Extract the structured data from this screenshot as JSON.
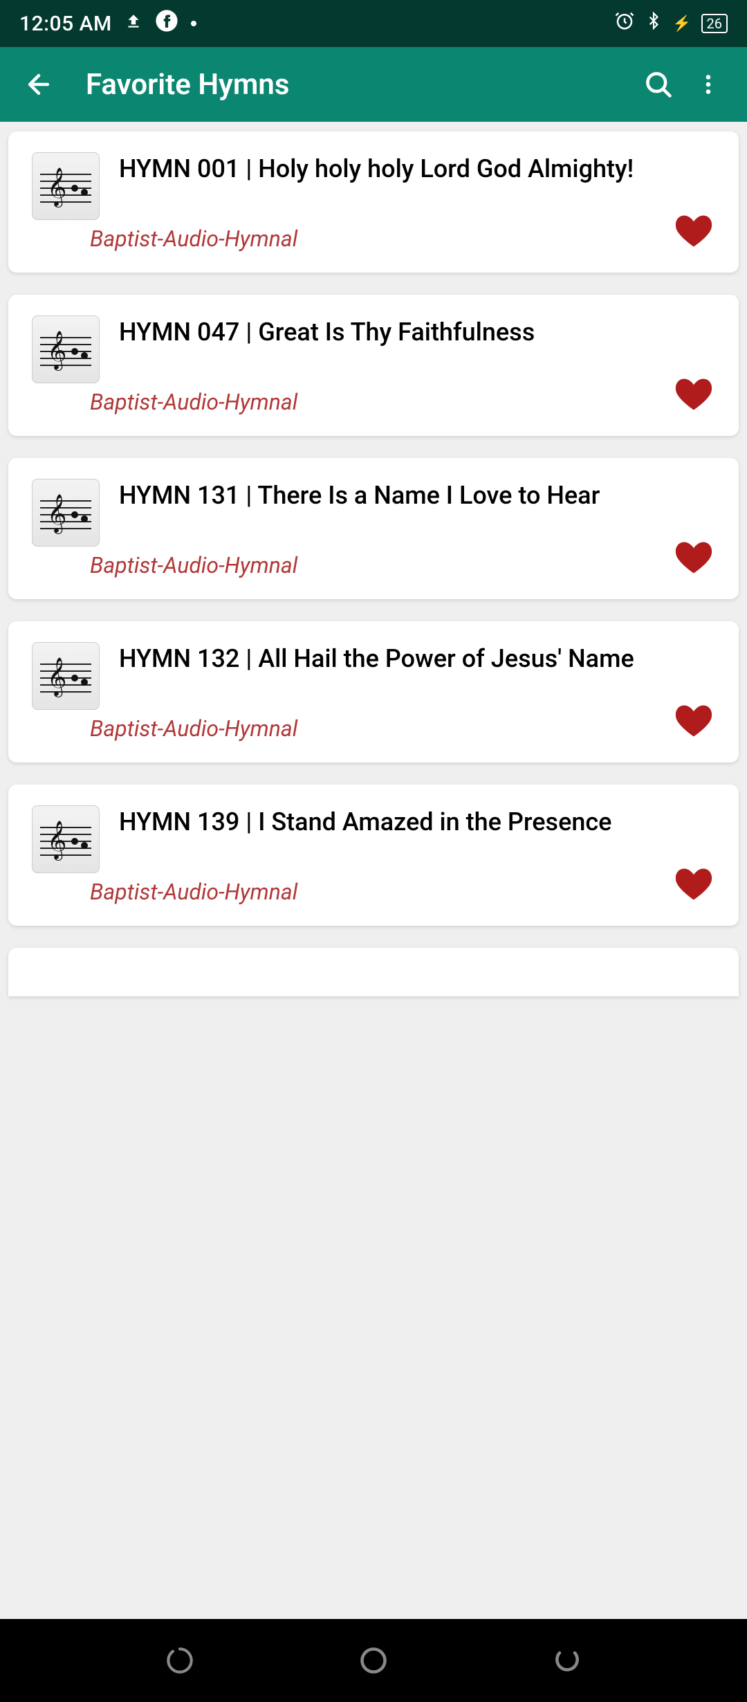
{
  "status": {
    "time": "12:05 AM",
    "battery": "26"
  },
  "header": {
    "title": "Favorite Hymns"
  },
  "hymns": [
    {
      "title": "HYMN 001 | Holy holy holy Lord God Almighty!",
      "source": "Baptist-Audio-Hymnal"
    },
    {
      "title": "HYMN 047 | Great Is Thy Faithfulness",
      "source": "Baptist-Audio-Hymnal"
    },
    {
      "title": "HYMN 131 | There Is a Name I Love to Hear",
      "source": "Baptist-Audio-Hymnal"
    },
    {
      "title": "HYMN 132 | All Hail the Power of Jesus' Name",
      "source": "Baptist-Audio-Hymnal"
    },
    {
      "title": "HYMN 139 | I Stand Amazed in the Presence",
      "source": "Baptist-Audio-Hymnal"
    }
  ]
}
